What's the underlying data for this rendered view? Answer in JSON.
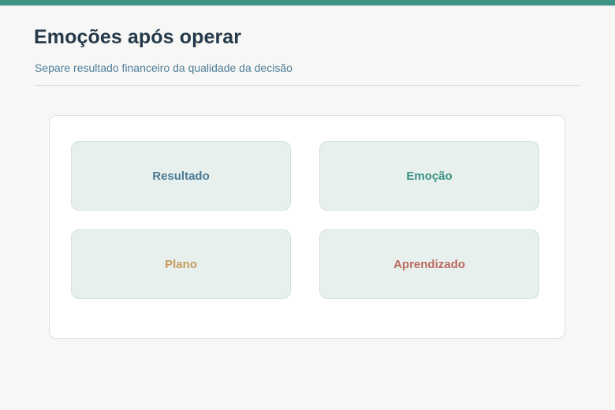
{
  "header": {
    "title": "Emoções após operar",
    "subtitle": "Separe resultado financeiro da qualidade da decisão"
  },
  "colors": {
    "accent": "#3f9384",
    "title": "#24394a",
    "subtitle": "#4d7c99",
    "tile_background": "#e8f0ed"
  },
  "tiles": [
    {
      "label": "Resultado",
      "color": "#4a7a96"
    },
    {
      "label": "Emoção",
      "color": "#3a9382"
    },
    {
      "label": "Plano",
      "color": "#c49a5c"
    },
    {
      "label": "Aprendizado",
      "color": "#b9675c"
    }
  ]
}
